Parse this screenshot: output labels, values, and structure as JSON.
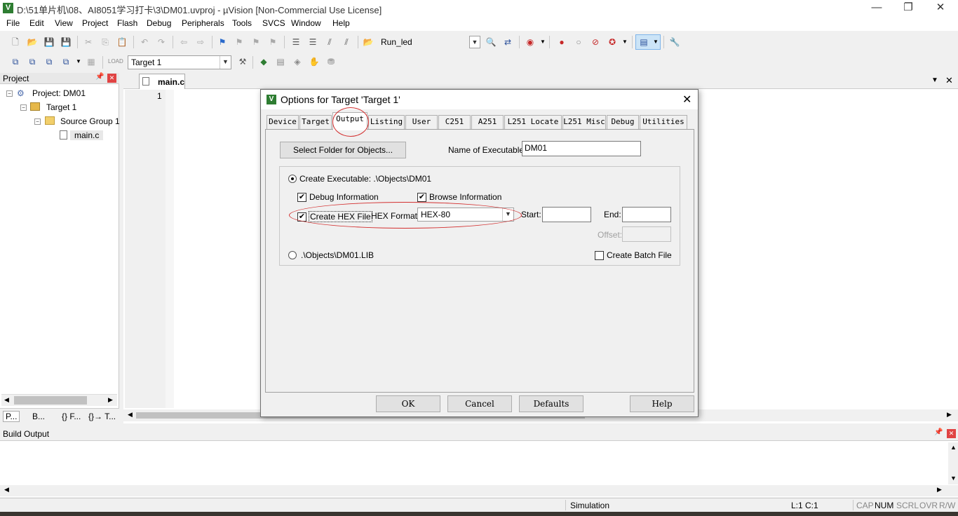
{
  "window": {
    "title": "D:\\51单片机\\08、AI8051学习打卡\\3\\DM01.uvproj - µVision  [Non-Commercial Use License]",
    "app_icon": "V",
    "minimize": "—",
    "restore": "❐",
    "close": "✕"
  },
  "menu": [
    "File",
    "Edit",
    "View",
    "Project",
    "Flash",
    "Debug",
    "Peripherals",
    "Tools",
    "SVCS",
    "Window",
    "Help"
  ],
  "toolbar1": {
    "target_combo_value": "Run_led"
  },
  "toolbar2": {
    "target_select_value": "Target 1"
  },
  "project_panel": {
    "header": "Project",
    "pin": "📌",
    "close": "✕",
    "tree": {
      "project": "Project: DM01",
      "target": "Target 1",
      "group": "Source Group 1",
      "file": "main.c"
    },
    "bottom_tabs": [
      "P...",
      "B...",
      "{} F...",
      "{}→ T..."
    ]
  },
  "editor": {
    "tab": "main.c",
    "line_number": "1"
  },
  "dialog": {
    "title": "Options for Target 'Target 1'",
    "close": "✕",
    "tabs": [
      "Device",
      "Target",
      "Output",
      "Listing",
      "User",
      "C251",
      "A251",
      "L251 Locate",
      "L251 Misc",
      "Debug",
      "Utilities"
    ],
    "active_tab": "Output",
    "select_folder_label": "Select Folder for Objects...",
    "name_exe_label": "Name of Executable:",
    "name_exe_value": "DM01",
    "create_exe_label": "Create Executable:  .\\Objects\\DM01",
    "create_exe_selected": true,
    "debug_info_label": "Debug Information",
    "debug_info_checked": true,
    "browse_info_label": "Browse Information",
    "browse_info_checked": true,
    "create_hex_label": "Create HEX File",
    "create_hex_checked": true,
    "hex_format_label": "HEX Format:",
    "hex_format_value": "HEX-80",
    "start_label": "Start:",
    "start_value": "",
    "end_label": "End:",
    "end_value": "",
    "offset_label": "Offset:",
    "offset_value": "",
    "create_lib_label": ".\\Objects\\DM01.LIB",
    "create_lib_selected": false,
    "create_batch_label": "Create Batch File",
    "create_batch_checked": false,
    "ok_label": "OK",
    "cancel_label": "Cancel",
    "defaults_label": "Defaults",
    "help_label": "Help",
    "annotation_color": "#d32f2f"
  },
  "build_output": {
    "header": "Build Output",
    "pin": "📌",
    "close": "✕"
  },
  "statusbar": {
    "mode": "Simulation",
    "position": "L:1 C:1",
    "caps": "CAP",
    "num": "NUM",
    "scrl": "SCRL",
    "ovr": "OVR",
    "rw": "R/W"
  }
}
